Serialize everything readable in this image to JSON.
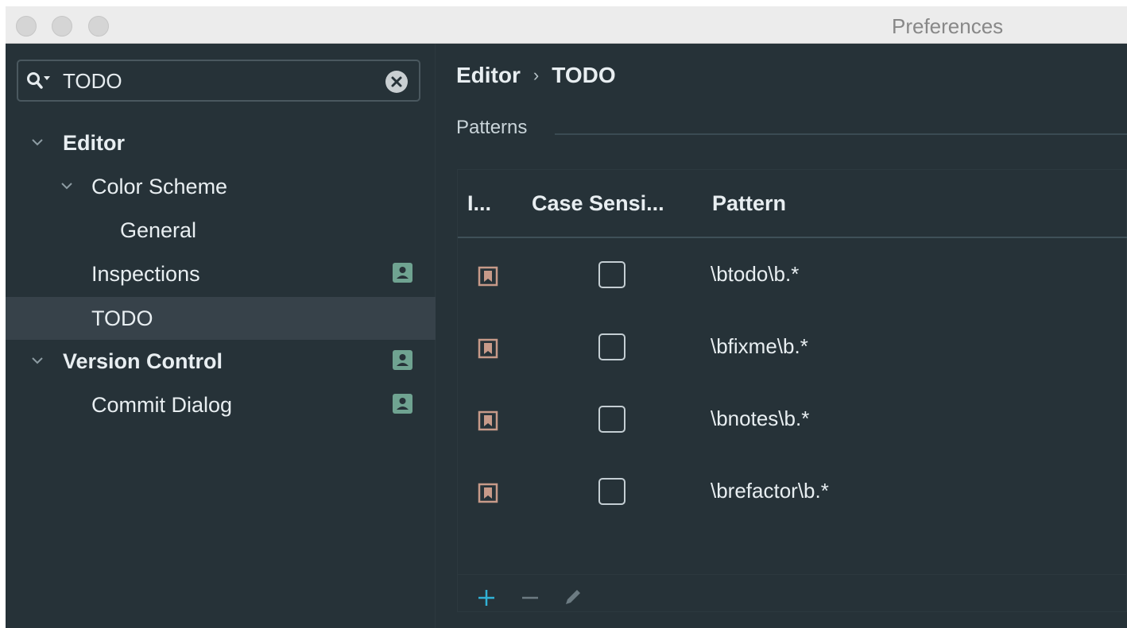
{
  "window": {
    "title": "Preferences"
  },
  "search": {
    "value": "TODO"
  },
  "tree": {
    "editor": "Editor",
    "color_scheme": "Color Scheme",
    "general": "General",
    "inspections": "Inspections",
    "todo": "TODO",
    "version_control": "Version Control",
    "commit_dialog": "Commit Dialog"
  },
  "breadcrumb": {
    "parent": "Editor",
    "separator": "›",
    "current": "TODO"
  },
  "patterns": {
    "group_label": "Patterns",
    "columns": [
      "I...",
      "Case Sensi...",
      "Pattern"
    ],
    "rows": [
      {
        "pattern": "\\btodo\\b.*",
        "case_sensitive": false
      },
      {
        "pattern": "\\bfixme\\b.*",
        "case_sensitive": false
      },
      {
        "pattern": "\\bnotes\\b.*",
        "case_sensitive": false
      },
      {
        "pattern": "\\brefactor\\b.*",
        "case_sensitive": false
      }
    ]
  },
  "toolbar": {
    "add_label": "+",
    "remove_label": "−"
  },
  "colors": {
    "background": "#263238",
    "selected_row": "#37424a",
    "badge": "#6fa391",
    "add_button": "#31b2d6",
    "todo_icon": "#c79a89"
  }
}
